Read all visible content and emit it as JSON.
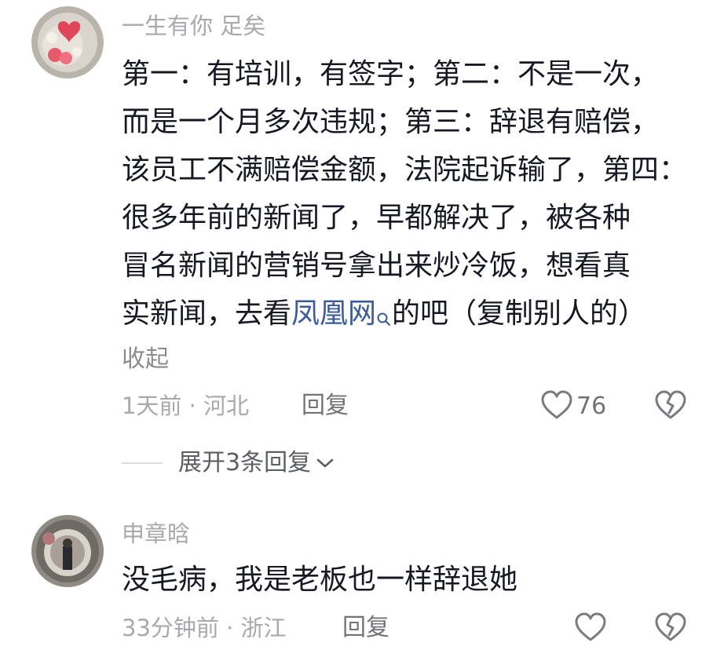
{
  "comments": [
    {
      "username": "一生有你 足矣",
      "content_lines": [
        "第一：有培训，有签字；第二：不是一次，",
        "而是一个月多次违规；第三：辞退有赔偿，",
        "该员工不满赔偿金额，法院起诉输了，第四：",
        "很多年前的新闻了，早都解决了，被各种",
        "冒名新闻的营销号拿出来炒冷饭，想看真"
      ],
      "last_line_before": "实新闻，去看",
      "keyword": "凤凰网",
      "last_line_after": "的吧（复制别人的）",
      "collapse_label": "收起",
      "meta": "1天前 · 河北",
      "reply_label": "回复",
      "like_count": "76",
      "expand_label": "展开3条回复"
    },
    {
      "username": "申章晗",
      "content": "没毛病，我是老板也一样辞退她",
      "meta": "33分钟前 · 浙江",
      "reply_label": "回复"
    }
  ],
  "icons": {
    "like": "heart-outline-icon",
    "dislike": "broken-heart-icon",
    "expand": "chevron-down-icon",
    "keyword_search": "search-icon"
  },
  "colors": {
    "text": "#161823",
    "secondary": "#a7a9ae",
    "link": "#3a5a9a"
  }
}
